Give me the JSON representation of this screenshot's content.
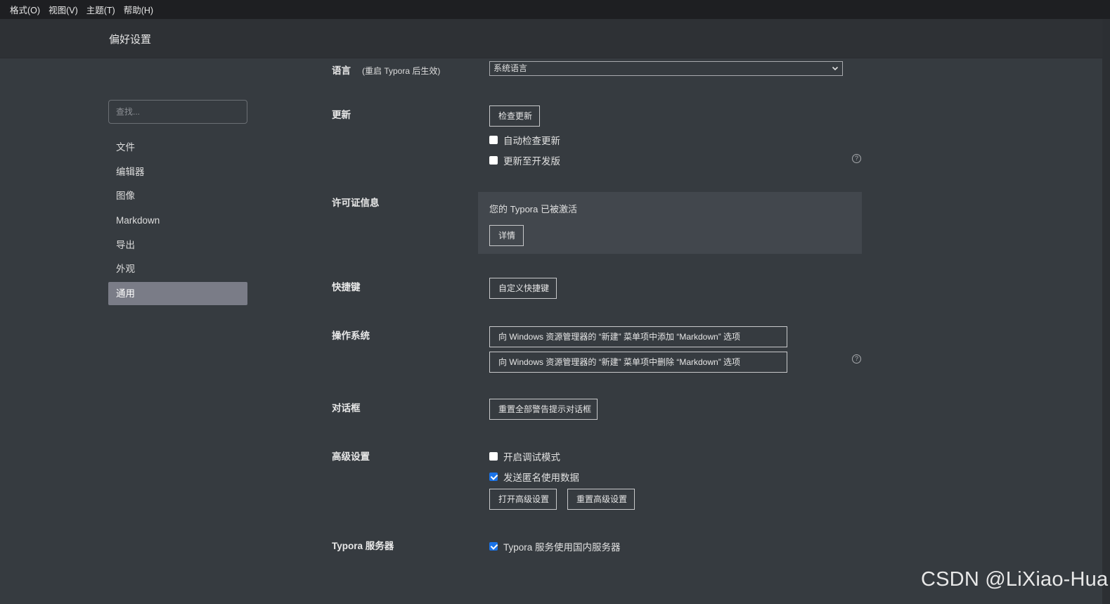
{
  "menu": [
    "格式(O)",
    "视图(V)",
    "主题(T)",
    "帮助(H)"
  ],
  "window_title": "偏好设置",
  "search": {
    "placeholder": "查找..."
  },
  "sidebar": {
    "items": [
      {
        "label": "文件"
      },
      {
        "label": "编辑器"
      },
      {
        "label": "图像"
      },
      {
        "label": "Markdown"
      },
      {
        "label": "导出"
      },
      {
        "label": "外观"
      },
      {
        "label": "通用"
      }
    ],
    "active_index": 6
  },
  "sections": {
    "language": {
      "label": "语言",
      "note": "(重启 Typora 后生效)",
      "select_value": "系统语言"
    },
    "update": {
      "label": "更新",
      "check_button": "检查更新",
      "auto_check": {
        "label": "自动检查更新",
        "checked": false
      },
      "dev_channel": {
        "label": "更新至开发版",
        "checked": false
      }
    },
    "license": {
      "label": "许可证信息",
      "message": "您的 Typora 已被激活",
      "details_button": "详情"
    },
    "shortcuts": {
      "label": "快捷键",
      "button": "自定义快捷键"
    },
    "os": {
      "label": "操作系统",
      "add_button": "向 Windows 资源管理器的 “新建” 菜单项中添加 “Markdown” 选项",
      "remove_button": "向 Windows 资源管理器的 “新建” 菜单项中删除 “Markdown” 选项"
    },
    "dialog": {
      "label": "对话框",
      "button": "重置全部警告提示对话框"
    },
    "advanced": {
      "label": "高级设置",
      "debug_mode": {
        "label": "开启调试模式",
        "checked": false
      },
      "anon_data": {
        "label": "发送匿名使用数据",
        "checked": true
      },
      "open_button": "打开高级设置",
      "reset_button": "重置高级设置"
    },
    "server": {
      "label": "Typora 服务器",
      "domestic": {
        "label": "Typora 服务使用国内服务器",
        "checked": true
      }
    }
  },
  "help_glyph": "?",
  "watermark": "CSDN @LiXiao-Hua",
  "colors": {
    "background": "#363b40",
    "menubar": "#1e1f22",
    "active_nav": "#7a7c87",
    "checkbox_checked": "#1a73e8"
  }
}
